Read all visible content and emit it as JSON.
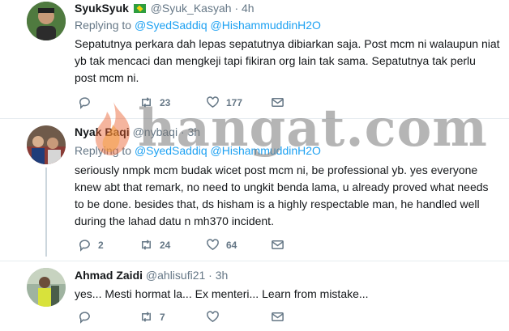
{
  "tweets": [
    {
      "name": "SyukSyuk",
      "handle": "@Syuk_Kasyah",
      "sep": "·",
      "time": "4h",
      "replying_prefix": "Replying to",
      "mentions": [
        "@SyedSaddiq",
        "@HishammuddinH2O"
      ],
      "text": "Sepatutnya perkara dah lepas sepatutnya dibiarkan saja. Post mcm ni walaupun niat yb tak mencaci dan mengkeji tapi fikiran org lain tak sama. Sepatutnya tak perlu post mcm ni.",
      "retweets": "23",
      "likes": "177"
    },
    {
      "name": "Nyak Baqi",
      "handle": "@nybaqi",
      "sep": "·",
      "time": "3h",
      "replying_prefix": "Replying to",
      "mentions": [
        "@SyedSaddiq",
        "@HishammuddinH2O"
      ],
      "text": "seriously nmpk mcm budak wicet post mcm ni, be professional yb. yes everyone knew abt that remark, no need to ungkit benda lama, u already proved what needs to be done. besides that, ds hisham is a highly respectable man, he handled well during the lahad datu n mh370 incident.",
      "replies": "2",
      "retweets": "24",
      "likes": "64"
    },
    {
      "name": "Ahmad Zaidi",
      "handle": "@ahlisufi21",
      "sep": "·",
      "time": "3h",
      "text": "yes... Mesti hormat la... Ex menteri... Learn from mistake...",
      "retweets": "7"
    }
  ],
  "watermark": {
    "text": "hangat.com"
  },
  "colors": {
    "link": "#1da1f2",
    "muted": "#657786",
    "text": "#14171a",
    "divider": "#e6ecf0"
  }
}
